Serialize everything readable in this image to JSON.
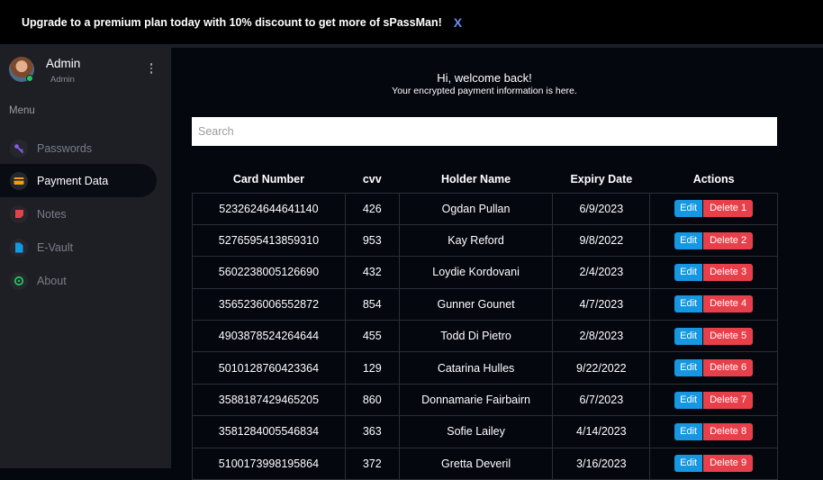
{
  "banner": {
    "text": "Upgrade to a premium plan today with 10% discount to get more of sPassMan!",
    "close": "X"
  },
  "sidebar": {
    "profile": {
      "name": "Admin",
      "role": "Admin"
    },
    "menu_label": "Menu",
    "items": [
      {
        "label": "Passwords",
        "icon": "key-icon",
        "color": "#8b5cf6"
      },
      {
        "label": "Payment Data",
        "icon": "credit-card-icon",
        "color": "#f59e0b",
        "active": true
      },
      {
        "label": "Notes",
        "icon": "note-icon",
        "color": "#e8404b"
      },
      {
        "label": "E-Vault",
        "icon": "file-icon",
        "color": "#1597e2"
      },
      {
        "label": "About",
        "icon": "info-icon",
        "color": "#22c55e"
      }
    ]
  },
  "main": {
    "greeting": "Hi, welcome back!",
    "subgreeting": "Your encrypted payment information is here.",
    "search_placeholder": "Search",
    "columns": [
      "Card Number",
      "cvv",
      "Holder Name",
      "Expiry Date",
      "Actions"
    ],
    "edit_label": "Edit",
    "rows": [
      {
        "card": "5232624644641140",
        "cvv": "426",
        "holder": "Ogdan Pullan",
        "expiry": "6/9/2023",
        "delete": "Delete 1"
      },
      {
        "card": "5276595413859310",
        "cvv": "953",
        "holder": "Kay Reford",
        "expiry": "9/8/2022",
        "delete": "Delete 2"
      },
      {
        "card": "5602238005126690",
        "cvv": "432",
        "holder": "Loydie Kordovani",
        "expiry": "2/4/2023",
        "delete": "Delete 3"
      },
      {
        "card": "3565236006552872",
        "cvv": "854",
        "holder": "Gunner Gounet",
        "expiry": "4/7/2023",
        "delete": "Delete 4"
      },
      {
        "card": "4903878524264644",
        "cvv": "455",
        "holder": "Todd Di Pietro",
        "expiry": "2/8/2023",
        "delete": "Delete 5"
      },
      {
        "card": "5010128760423364",
        "cvv": "129",
        "holder": "Catarina Hulles",
        "expiry": "9/22/2022",
        "delete": "Delete 6"
      },
      {
        "card": "3588187429465205",
        "cvv": "860",
        "holder": "Donnamarie Fairbairn",
        "expiry": "6/7/2023",
        "delete": "Delete 7"
      },
      {
        "card": "3581284005546834",
        "cvv": "363",
        "holder": "Sofie Lailey",
        "expiry": "4/14/2023",
        "delete": "Delete 8"
      },
      {
        "card": "5100173998195864",
        "cvv": "372",
        "holder": "Gretta Deveril",
        "expiry": "3/16/2023",
        "delete": "Delete 9"
      }
    ]
  }
}
